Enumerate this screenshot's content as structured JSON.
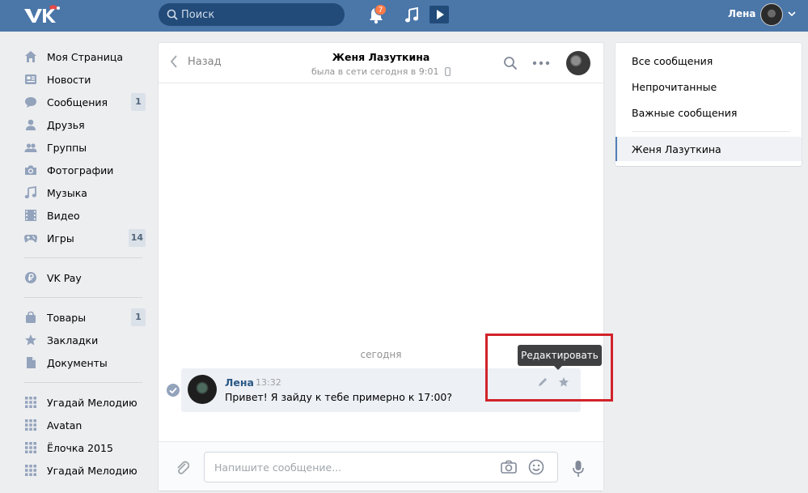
{
  "header": {
    "search_placeholder": "Поиск",
    "notifications_count": "7",
    "user_name": "Лена"
  },
  "sidebar": {
    "groups": [
      [
        {
          "label": "Моя Страница",
          "icon": "home-icon"
        },
        {
          "label": "Новости",
          "icon": "news-icon"
        },
        {
          "label": "Сообщения",
          "icon": "messages-icon",
          "count": "1"
        },
        {
          "label": "Друзья",
          "icon": "friend-icon"
        },
        {
          "label": "Группы",
          "icon": "groups-icon"
        },
        {
          "label": "Фотографии",
          "icon": "camera-icon"
        },
        {
          "label": "Музыка",
          "icon": "music-note-icon"
        },
        {
          "label": "Видео",
          "icon": "film-icon"
        },
        {
          "label": "Игры",
          "icon": "gamepad-icon",
          "count": "14"
        }
      ],
      [
        {
          "label": "VK Pay",
          "icon": "ruble-coin-icon"
        }
      ],
      [
        {
          "label": "Товары",
          "icon": "shopping-bag-icon",
          "count": "1"
        },
        {
          "label": "Закладки",
          "icon": "star-icon"
        },
        {
          "label": "Документы",
          "icon": "document-icon"
        }
      ],
      [
        {
          "label": "Угадай Мелодию",
          "icon": "app-grid-icon"
        },
        {
          "label": "Avatan",
          "icon": "app-grid-icon"
        },
        {
          "label": "Ёлочка 2015",
          "icon": "app-grid-icon"
        },
        {
          "label": "Угадай Мелодию",
          "icon": "app-grid-icon"
        }
      ]
    ]
  },
  "chat": {
    "back_label": "Назад",
    "peer_name": "Женя Лазуткина",
    "peer_status": "была в сети сегодня в 9:01",
    "date_separator": "сегодня",
    "message": {
      "author": "Лена",
      "time": "13:32",
      "text": "Привет! Я зайду к тебе примерно к 17:00?"
    },
    "tooltip": "Редактировать",
    "composer_placeholder": "Напишите сообщение..."
  },
  "filters": {
    "items": [
      "Все сообщения",
      "Непрочитанные",
      "Важные сообщения"
    ],
    "active": "Женя Лазуткина"
  },
  "colors": {
    "header_bg": "#4a76a8",
    "link": "#2a5885",
    "highlight_box": "#d1232a",
    "badge": "#ff7b47"
  }
}
